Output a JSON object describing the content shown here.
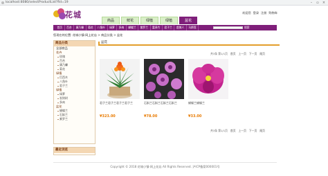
{
  "browser": {
    "url": "localhost:8080/selectProductList?fid=19"
  },
  "header": {
    "logo_text": "花城",
    "top_links": [
      "欢迎您",
      "登录",
      "注册",
      "购物车"
    ],
    "category_tabs": [
      "商品",
      "鲜花",
      "绿植",
      "绿植",
      "盆花"
    ]
  },
  "nav": {
    "items": [
      "首页",
      "百合",
      "康乃馨",
      "菊花",
      "八角叶",
      "绿萝",
      "多肉",
      "蝴蝶兰",
      "紫罗兰",
      "富贵竹",
      "君子兰",
      "虞美人",
      "马蹄莲"
    ],
    "search_placeholder": "",
    "search_button": "搜索"
  },
  "breadcrumb": {
    "prefix": "您现在的位置:",
    "path": "花城小镇-网上花店 > 商品分类 > 盆花"
  },
  "sidebar": {
    "title": "商品分类",
    "all_label": "全部商品",
    "groups": [
      {
        "name": "花卉",
        "items": [
          "玫瑰",
          "百合",
          "康乃馨",
          "菊花"
        ]
      },
      {
        "name": "绿植",
        "items": [
          "巴西木",
          "八角叶",
          "君子兰"
        ]
      },
      {
        "name": "绿植",
        "items": [
          "绿萝",
          "发财树",
          "多肉"
        ]
      },
      {
        "name": "盆花",
        "items": [
          "蝴蝶兰",
          "石斛兰",
          "紫罗兰"
        ]
      }
    ],
    "recent_title": "最近浏览"
  },
  "main": {
    "title": "盆花",
    "pager_top": {
      "info": "共3条 第1/1页",
      "first": "首页",
      "prev": "上一页",
      "next": "下一页",
      "last": "尾页"
    },
    "pager_bottom": {
      "info": "共3条 第1/1页",
      "first": "首页",
      "prev": "上一页",
      "next": "下一页",
      "last": "尾页"
    },
    "products": [
      {
        "name": "君子兰君子兰君子兰君子兰",
        "price": "¥323.00"
      },
      {
        "name": "石斛兰石斛兰石斛兰石斛兰",
        "price": "¥78.00"
      },
      {
        "name": "蝴蝶兰蝴蝶兰",
        "price": "¥33.00"
      }
    ]
  },
  "footer": {
    "text": "Copyright © 2018 花城小镇-网上花店 All Rights Reserved. 沪ICP备案000001号"
  },
  "colors": {
    "brand_purple": "#7f1f7a",
    "price_orange": "#e87a00",
    "accent_orange": "#e39e2b"
  }
}
